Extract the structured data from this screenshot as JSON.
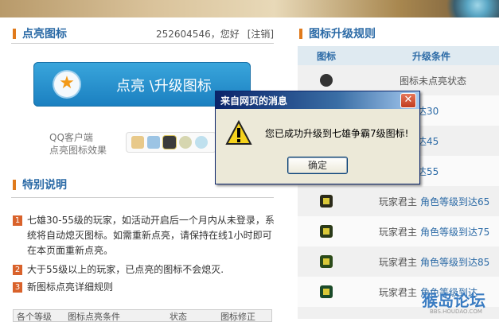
{
  "left": {
    "section1_title": "点亮图标",
    "user_id": "252604546，您好",
    "logout": "[注销]",
    "main_button": "点亮 \\升级图标",
    "qq_line1": "QQ客户端",
    "qq_line2": "点亮图标效果",
    "section2_title": "特别说明",
    "notes": [
      {
        "num": "1",
        "text": "七雄30-55级的玩家，如活动开启后一个月内从未登录，系统将自动熄灭图标。如需重新点亮，请保持在线1小时即可在本页面重新点亮。"
      },
      {
        "num": "2",
        "text": "大于55级以上的玩家，已点亮的图标不会熄灭."
      },
      {
        "num": "3",
        "text": "新图标点亮详细规则"
      }
    ],
    "tabs": [
      "各个等级",
      "图标点亮条件",
      "状态",
      "图标修正"
    ]
  },
  "right": {
    "title": "图标升级规则",
    "col_icon": "图标",
    "col_cond": "升级条件",
    "rows": [
      {
        "kind": "",
        "cond": "图标未点亮状态"
      },
      {
        "kind": "",
        "cond": "角色等级到达30"
      },
      {
        "kind": "",
        "cond": "角色等级到达45"
      },
      {
        "kind": "",
        "cond": "角色等级到达55"
      },
      {
        "kind": "玩家君主",
        "cond": "角色等级到达65"
      },
      {
        "kind": "玩家君主",
        "cond": "角色等级到达75"
      },
      {
        "kind": "玩家君主",
        "cond": "角色等级到达85"
      },
      {
        "kind": "玩家君主",
        "cond": "角色等级到达"
      }
    ]
  },
  "dialog": {
    "title": "来自网页的消息",
    "message": "您已成功升级到七雄争霸7级图标!",
    "ok": "确定",
    "close_glyph": "✕"
  },
  "watermark": {
    "text": "猴岛论坛",
    "url": "BBS.HOUDAO.COM"
  },
  "colors": {
    "accent": "#2b6aa6",
    "orange": "#e07a1c",
    "button": "#1a7fc0"
  }
}
